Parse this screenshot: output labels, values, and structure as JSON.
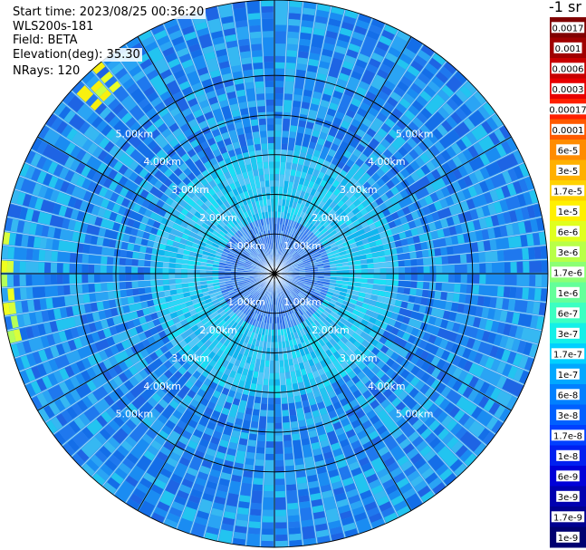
{
  "info": {
    "start_time": "Start time: 2023/08/25 00:36:20",
    "device": "WLS200s-181",
    "field": "Field: BETA",
    "elevation": "Elevation(deg): 35.30",
    "nrays": "NRays: 120"
  },
  "colors": {
    "background": "#ffffff",
    "grid": "#000000",
    "range_label": "#ffffff"
  },
  "chart_data": {
    "type": "heatmap",
    "projection": "polar-ppi",
    "field": "BETA",
    "n_rays": 120,
    "elevation_deg": 35.3,
    "range_ring_labels": [
      "1.00km",
      "2.00km",
      "3.00km",
      "4.00km",
      "5.00km"
    ],
    "range_rings_km": [
      1,
      2,
      3,
      4,
      5
    ],
    "max_range_km": 6.9,
    "radial_spokes_deg": [
      0,
      30,
      60,
      90,
      120,
      150,
      180,
      210,
      240,
      270,
      300,
      330
    ],
    "colorbar": {
      "title": "-1 sr",
      "tick_labels": [
        "0.0017",
        "0.001",
        "0.0006",
        "0.0003",
        "0.00017",
        "0.0001",
        "6e-5",
        "3e-5",
        "1.7e-5",
        "1e-5",
        "6e-6",
        "3e-6",
        "1.7e-6",
        "1e-6",
        "6e-7",
        "3e-7",
        "1.7e-7",
        "1e-7",
        "6e-8",
        "3e-8",
        "1.7e-8",
        "1e-8",
        "6e-9",
        "3e-9",
        "1.7e-9",
        "1e-9"
      ],
      "segment_colors": [
        "#800000",
        "#a00000",
        "#c80000",
        "#e80000",
        "#ff2000",
        "#ff5a00",
        "#ff8c00",
        "#ffb000",
        "#ffd200",
        "#fff000",
        "#e0ff1e",
        "#b8ff48",
        "#8cff74",
        "#64ff9a",
        "#3cffc2",
        "#14f0e8",
        "#00d0ff",
        "#00a8ff",
        "#0080ff",
        "#0060ff",
        "#0040ff",
        "#0020f0",
        "#0000d8",
        "#0000b0",
        "#000090",
        "#000070"
      ]
    },
    "dominant_value_range": [
      "1e-8",
      "1.7e-7"
    ]
  }
}
